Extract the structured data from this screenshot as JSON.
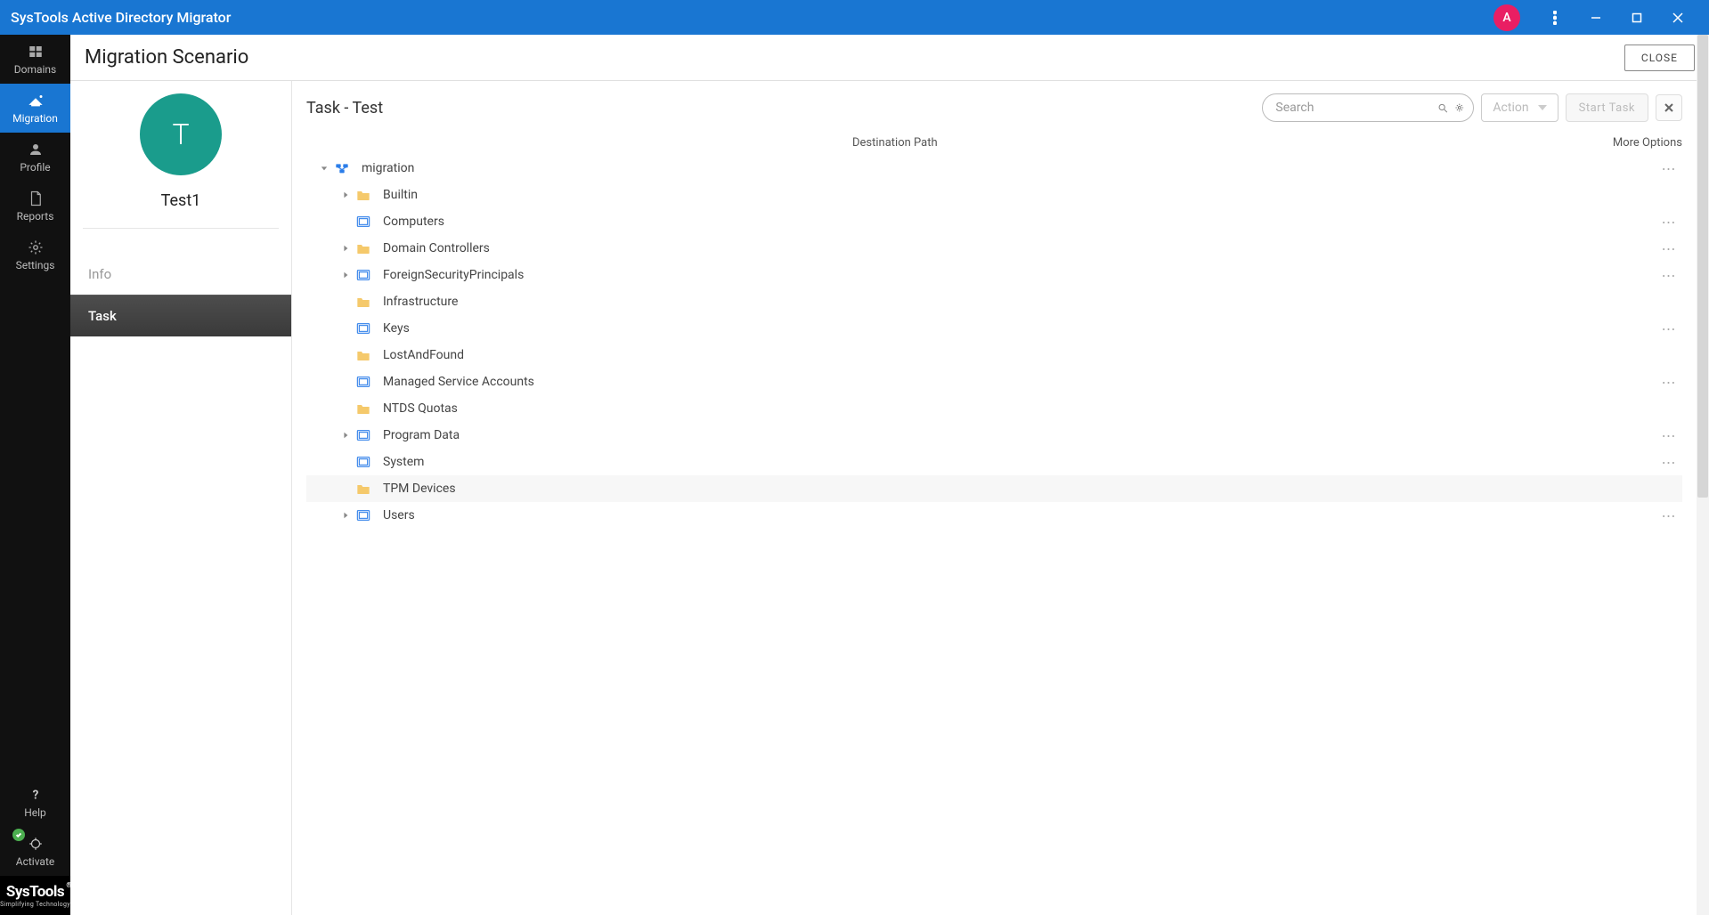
{
  "titlebar": {
    "title": "SysTools Active Directory Migrator",
    "avatar_letter": "A"
  },
  "nav": {
    "items": [
      {
        "id": "domains",
        "label": "Domains",
        "selected": false
      },
      {
        "id": "migration",
        "label": "Migration",
        "selected": true
      },
      {
        "id": "profile",
        "label": "Profile",
        "selected": false
      },
      {
        "id": "reports",
        "label": "Reports",
        "selected": false
      },
      {
        "id": "settings",
        "label": "Settings",
        "selected": false
      }
    ],
    "help_label": "Help",
    "activate_label": "Activate"
  },
  "brand": {
    "name": "SysTools",
    "sub": "Simplifying Technology"
  },
  "header": {
    "title": "Migration Scenario",
    "close_label": "CLOSE"
  },
  "left_panel": {
    "avatar_letter": "T",
    "avatar_name": "Test1",
    "tabs": [
      {
        "label": "Info",
        "active": false
      },
      {
        "label": "Task",
        "active": true
      }
    ]
  },
  "task": {
    "title": "Task - Test",
    "search_placeholder": "Search",
    "action_label": "Action",
    "start_task_label": "Start Task",
    "columns": {
      "dest": "Destination Path",
      "more": "More Options"
    }
  },
  "tree": [
    {
      "depth": 0,
      "exp": "down",
      "icon": "domain",
      "label": "migration",
      "more": true,
      "hovered": false
    },
    {
      "depth": 1,
      "exp": "right",
      "icon": "folder",
      "label": "Builtin",
      "more": false,
      "hovered": false
    },
    {
      "depth": 1,
      "exp": "",
      "icon": "container",
      "label": "Computers",
      "more": true,
      "hovered": false
    },
    {
      "depth": 1,
      "exp": "right",
      "icon": "folder",
      "label": "Domain Controllers",
      "more": true,
      "hovered": false
    },
    {
      "depth": 1,
      "exp": "right",
      "icon": "container",
      "label": "ForeignSecurityPrincipals",
      "more": true,
      "hovered": false
    },
    {
      "depth": 1,
      "exp": "",
      "icon": "folder",
      "label": "Infrastructure",
      "more": false,
      "hovered": false
    },
    {
      "depth": 1,
      "exp": "",
      "icon": "container",
      "label": "Keys",
      "more": true,
      "hovered": false
    },
    {
      "depth": 1,
      "exp": "",
      "icon": "folder",
      "label": "LostAndFound",
      "more": false,
      "hovered": false
    },
    {
      "depth": 1,
      "exp": "",
      "icon": "container",
      "label": "Managed Service Accounts",
      "more": true,
      "hovered": false
    },
    {
      "depth": 1,
      "exp": "",
      "icon": "folder",
      "label": "NTDS Quotas",
      "more": false,
      "hovered": false
    },
    {
      "depth": 1,
      "exp": "right",
      "icon": "container",
      "label": "Program Data",
      "more": true,
      "hovered": false
    },
    {
      "depth": 1,
      "exp": "",
      "icon": "container",
      "label": "System",
      "more": true,
      "hovered": false
    },
    {
      "depth": 1,
      "exp": "",
      "icon": "folder",
      "label": "TPM Devices",
      "more": false,
      "hovered": true
    },
    {
      "depth": 1,
      "exp": "right",
      "icon": "container",
      "label": "Users",
      "more": true,
      "hovered": false
    }
  ]
}
